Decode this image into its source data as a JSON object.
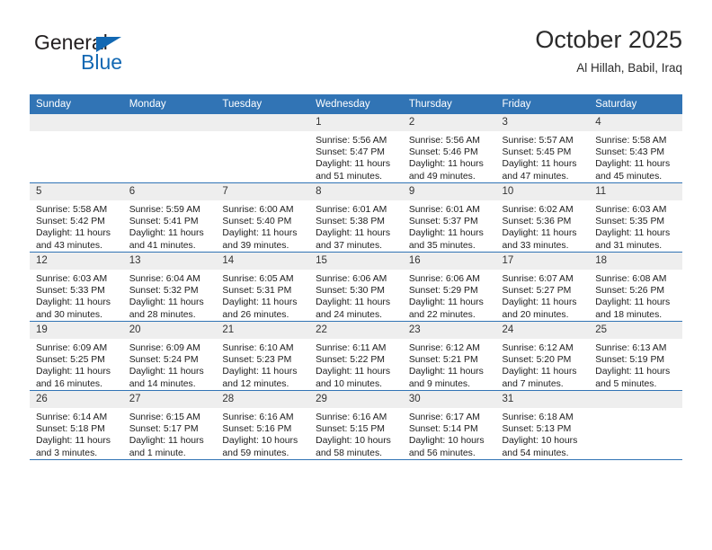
{
  "brand": {
    "name_top": "General",
    "name_bottom": "Blue",
    "triangle_color": "#1268b3"
  },
  "header": {
    "title": "October 2025",
    "subtitle": "Al Hillah, Babil, Iraq"
  },
  "theme": {
    "header_blue": "#3174b5",
    "daynum_gray": "#eeeeee",
    "text": "#1d1d1d"
  },
  "weekday_headers": [
    "Sunday",
    "Monday",
    "Tuesday",
    "Wednesday",
    "Thursday",
    "Friday",
    "Saturday"
  ],
  "weeks": [
    [
      {
        "day": "",
        "sunrise": "",
        "sunset": "",
        "daylight1": "",
        "daylight2": "",
        "empty": true
      },
      {
        "day": "",
        "sunrise": "",
        "sunset": "",
        "daylight1": "",
        "daylight2": "",
        "empty": true
      },
      {
        "day": "",
        "sunrise": "",
        "sunset": "",
        "daylight1": "",
        "daylight2": "",
        "empty": true
      },
      {
        "day": "1",
        "sunrise": "Sunrise: 5:56 AM",
        "sunset": "Sunset: 5:47 PM",
        "daylight1": "Daylight: 11 hours",
        "daylight2": "and 51 minutes.",
        "empty": false
      },
      {
        "day": "2",
        "sunrise": "Sunrise: 5:56 AM",
        "sunset": "Sunset: 5:46 PM",
        "daylight1": "Daylight: 11 hours",
        "daylight2": "and 49 minutes.",
        "empty": false
      },
      {
        "day": "3",
        "sunrise": "Sunrise: 5:57 AM",
        "sunset": "Sunset: 5:45 PM",
        "daylight1": "Daylight: 11 hours",
        "daylight2": "and 47 minutes.",
        "empty": false
      },
      {
        "day": "4",
        "sunrise": "Sunrise: 5:58 AM",
        "sunset": "Sunset: 5:43 PM",
        "daylight1": "Daylight: 11 hours",
        "daylight2": "and 45 minutes.",
        "empty": false
      }
    ],
    [
      {
        "day": "5",
        "sunrise": "Sunrise: 5:58 AM",
        "sunset": "Sunset: 5:42 PM",
        "daylight1": "Daylight: 11 hours",
        "daylight2": "and 43 minutes.",
        "empty": false
      },
      {
        "day": "6",
        "sunrise": "Sunrise: 5:59 AM",
        "sunset": "Sunset: 5:41 PM",
        "daylight1": "Daylight: 11 hours",
        "daylight2": "and 41 minutes.",
        "empty": false
      },
      {
        "day": "7",
        "sunrise": "Sunrise: 6:00 AM",
        "sunset": "Sunset: 5:40 PM",
        "daylight1": "Daylight: 11 hours",
        "daylight2": "and 39 minutes.",
        "empty": false
      },
      {
        "day": "8",
        "sunrise": "Sunrise: 6:01 AM",
        "sunset": "Sunset: 5:38 PM",
        "daylight1": "Daylight: 11 hours",
        "daylight2": "and 37 minutes.",
        "empty": false
      },
      {
        "day": "9",
        "sunrise": "Sunrise: 6:01 AM",
        "sunset": "Sunset: 5:37 PM",
        "daylight1": "Daylight: 11 hours",
        "daylight2": "and 35 minutes.",
        "empty": false
      },
      {
        "day": "10",
        "sunrise": "Sunrise: 6:02 AM",
        "sunset": "Sunset: 5:36 PM",
        "daylight1": "Daylight: 11 hours",
        "daylight2": "and 33 minutes.",
        "empty": false
      },
      {
        "day": "11",
        "sunrise": "Sunrise: 6:03 AM",
        "sunset": "Sunset: 5:35 PM",
        "daylight1": "Daylight: 11 hours",
        "daylight2": "and 31 minutes.",
        "empty": false
      }
    ],
    [
      {
        "day": "12",
        "sunrise": "Sunrise: 6:03 AM",
        "sunset": "Sunset: 5:33 PM",
        "daylight1": "Daylight: 11 hours",
        "daylight2": "and 30 minutes.",
        "empty": false
      },
      {
        "day": "13",
        "sunrise": "Sunrise: 6:04 AM",
        "sunset": "Sunset: 5:32 PM",
        "daylight1": "Daylight: 11 hours",
        "daylight2": "and 28 minutes.",
        "empty": false
      },
      {
        "day": "14",
        "sunrise": "Sunrise: 6:05 AM",
        "sunset": "Sunset: 5:31 PM",
        "daylight1": "Daylight: 11 hours",
        "daylight2": "and 26 minutes.",
        "empty": false
      },
      {
        "day": "15",
        "sunrise": "Sunrise: 6:06 AM",
        "sunset": "Sunset: 5:30 PM",
        "daylight1": "Daylight: 11 hours",
        "daylight2": "and 24 minutes.",
        "empty": false
      },
      {
        "day": "16",
        "sunrise": "Sunrise: 6:06 AM",
        "sunset": "Sunset: 5:29 PM",
        "daylight1": "Daylight: 11 hours",
        "daylight2": "and 22 minutes.",
        "empty": false
      },
      {
        "day": "17",
        "sunrise": "Sunrise: 6:07 AM",
        "sunset": "Sunset: 5:27 PM",
        "daylight1": "Daylight: 11 hours",
        "daylight2": "and 20 minutes.",
        "empty": false
      },
      {
        "day": "18",
        "sunrise": "Sunrise: 6:08 AM",
        "sunset": "Sunset: 5:26 PM",
        "daylight1": "Daylight: 11 hours",
        "daylight2": "and 18 minutes.",
        "empty": false
      }
    ],
    [
      {
        "day": "19",
        "sunrise": "Sunrise: 6:09 AM",
        "sunset": "Sunset: 5:25 PM",
        "daylight1": "Daylight: 11 hours",
        "daylight2": "and 16 minutes.",
        "empty": false
      },
      {
        "day": "20",
        "sunrise": "Sunrise: 6:09 AM",
        "sunset": "Sunset: 5:24 PM",
        "daylight1": "Daylight: 11 hours",
        "daylight2": "and 14 minutes.",
        "empty": false
      },
      {
        "day": "21",
        "sunrise": "Sunrise: 6:10 AM",
        "sunset": "Sunset: 5:23 PM",
        "daylight1": "Daylight: 11 hours",
        "daylight2": "and 12 minutes.",
        "empty": false
      },
      {
        "day": "22",
        "sunrise": "Sunrise: 6:11 AM",
        "sunset": "Sunset: 5:22 PM",
        "daylight1": "Daylight: 11 hours",
        "daylight2": "and 10 minutes.",
        "empty": false
      },
      {
        "day": "23",
        "sunrise": "Sunrise: 6:12 AM",
        "sunset": "Sunset: 5:21 PM",
        "daylight1": "Daylight: 11 hours",
        "daylight2": "and 9 minutes.",
        "empty": false
      },
      {
        "day": "24",
        "sunrise": "Sunrise: 6:12 AM",
        "sunset": "Sunset: 5:20 PM",
        "daylight1": "Daylight: 11 hours",
        "daylight2": "and 7 minutes.",
        "empty": false
      },
      {
        "day": "25",
        "sunrise": "Sunrise: 6:13 AM",
        "sunset": "Sunset: 5:19 PM",
        "daylight1": "Daylight: 11 hours",
        "daylight2": "and 5 minutes.",
        "empty": false
      }
    ],
    [
      {
        "day": "26",
        "sunrise": "Sunrise: 6:14 AM",
        "sunset": "Sunset: 5:18 PM",
        "daylight1": "Daylight: 11 hours",
        "daylight2": "and 3 minutes.",
        "empty": false
      },
      {
        "day": "27",
        "sunrise": "Sunrise: 6:15 AM",
        "sunset": "Sunset: 5:17 PM",
        "daylight1": "Daylight: 11 hours",
        "daylight2": "and 1 minute.",
        "empty": false
      },
      {
        "day": "28",
        "sunrise": "Sunrise: 6:16 AM",
        "sunset": "Sunset: 5:16 PM",
        "daylight1": "Daylight: 10 hours",
        "daylight2": "and 59 minutes.",
        "empty": false
      },
      {
        "day": "29",
        "sunrise": "Sunrise: 6:16 AM",
        "sunset": "Sunset: 5:15 PM",
        "daylight1": "Daylight: 10 hours",
        "daylight2": "and 58 minutes.",
        "empty": false
      },
      {
        "day": "30",
        "sunrise": "Sunrise: 6:17 AM",
        "sunset": "Sunset: 5:14 PM",
        "daylight1": "Daylight: 10 hours",
        "daylight2": "and 56 minutes.",
        "empty": false
      },
      {
        "day": "31",
        "sunrise": "Sunrise: 6:18 AM",
        "sunset": "Sunset: 5:13 PM",
        "daylight1": "Daylight: 10 hours",
        "daylight2": "and 54 minutes.",
        "empty": false
      },
      {
        "day": "",
        "sunrise": "",
        "sunset": "",
        "daylight1": "",
        "daylight2": "",
        "empty": true
      }
    ]
  ]
}
